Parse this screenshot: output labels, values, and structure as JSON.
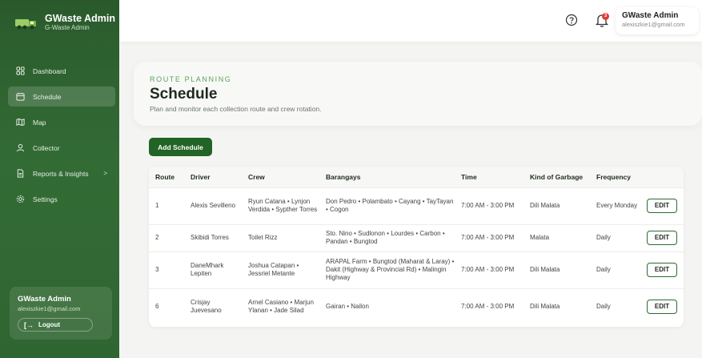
{
  "brand": {
    "title": "GWaste Admin",
    "subtitle": "G-Waste Admin"
  },
  "nav": {
    "items": [
      {
        "label": "Dashboard",
        "icon": "grid-icon"
      },
      {
        "label": "Schedule",
        "icon": "calendar-icon",
        "active": true
      },
      {
        "label": "Map",
        "icon": "map-icon"
      },
      {
        "label": "Collector",
        "icon": "user-icon"
      },
      {
        "label": "Reports & Insights",
        "icon": "report-icon",
        "chevron": ">"
      },
      {
        "label": "Settings",
        "icon": "gear-icon"
      }
    ]
  },
  "profile": {
    "name": "GWaste Admin",
    "email": "alexiszkie1@gmail.com",
    "logout_label": "Logout",
    "logout_icon": "[→"
  },
  "topbar": {
    "help_icon": "question-icon",
    "bell_icon": "bell-icon",
    "notifications": "3",
    "user_name": "GWaste Admin",
    "user_email": "alexiszkie1@gmail.com"
  },
  "header": {
    "eyebrow": "ROUTE PLANNING",
    "title": "Schedule",
    "subtitle": "Plan and monitor each collection route and crew rotation."
  },
  "add_button": "Add Schedule",
  "table": {
    "headers": [
      "Route",
      "Driver",
      "Crew",
      "Barangays",
      "Time",
      "Kind of Garbage",
      "Frequency",
      ""
    ],
    "rows": [
      {
        "route": "1",
        "driver": "Alexis Sevilleno",
        "crew": "Ryun Catana • Lynjon Verdida • Sypther Torres",
        "barangays": "Don Pedro • Polambato • Cayang • TayTayan • Cogon",
        "time": "7:00 AM - 3:00 PM",
        "garbage": "Dili Malata",
        "frequency": "Every Monday",
        "action": "EDIT"
      },
      {
        "route": "2",
        "driver": "Skibidi Torres",
        "crew": "Toilet Rizz",
        "barangays": "Sto. Nino • Sudlonon • Lourdes • Carbon • Pandan • Bungtod",
        "time": "7:00 AM - 3:00 PM",
        "garbage": "Malata",
        "frequency": "Daily",
        "action": "EDIT"
      },
      {
        "route": "3",
        "driver": "DaneMhark Lepiten",
        "crew": "Joshua Catapan • Jessriel Metante",
        "barangays": "ARAPAL Farm • Bungtod (Maharat & Laray) • Dakit (Highway & Provincial Rd) • Malingin Highway",
        "time": "7:00 AM - 3:00 PM",
        "garbage": "Dili Malata",
        "frequency": "Daily",
        "action": "EDIT"
      },
      {
        "route": "6",
        "driver": "Crisjay Juevesano",
        "crew": "Arnel Casiano • Marjun Ylanan • Jade Silad",
        "barangays": "Gairan • Nailon",
        "time": "7:00 AM - 3:00 PM",
        "garbage": "Dili Malata",
        "frequency": "Daily",
        "action": "EDIT"
      }
    ]
  },
  "colors": {
    "sidebar": "#2f6531",
    "accent": "#226326",
    "eyebrow": "#5aa25a",
    "badge": "#e53935"
  }
}
